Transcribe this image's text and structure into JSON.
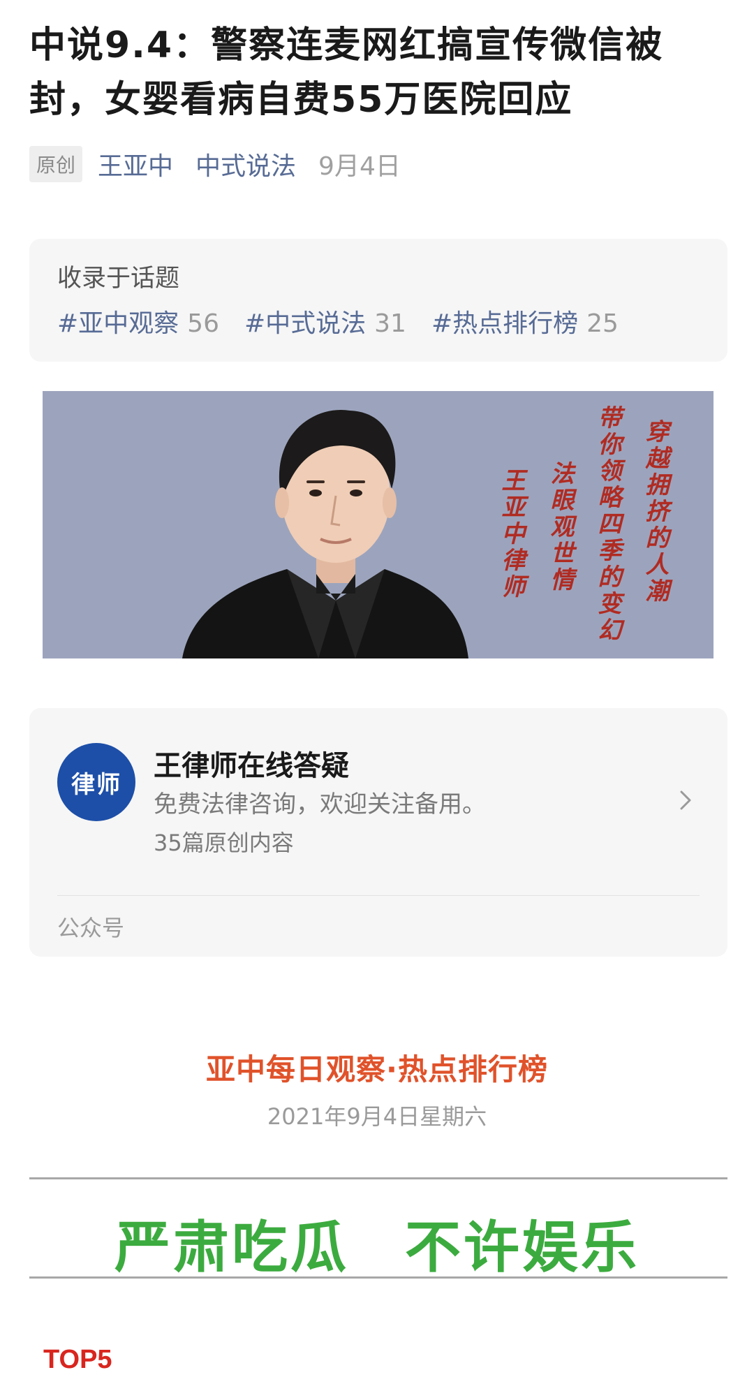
{
  "article": {
    "title": "中说9.4：警察连麦网红搞宣传微信被封，女婴看病自费55万医院回应",
    "original_badge": "原创",
    "author": "王亚中",
    "account": "中式说法",
    "date": "9月4日"
  },
  "topics": {
    "label": "收录于话题",
    "tags": [
      {
        "name": "#亚中观察",
        "count": "56"
      },
      {
        "name": "#中式说法",
        "count": "31"
      },
      {
        "name": "#热点排行榜",
        "count": "25"
      }
    ]
  },
  "banner": {
    "calligraphy_lines": [
      "穿越拥挤的人潮",
      "带你领略四季的变幻",
      "法眼观世情",
      "王亚中律师"
    ]
  },
  "account_card": {
    "avatar_text": "律师",
    "name": "王律师在线答疑",
    "description": "免费法律咨询，欢迎关注备用。",
    "count": "35篇原创内容",
    "type": "公众号"
  },
  "section": {
    "heading": "亚中每日观察·热点排行榜",
    "date": "2021年9月4日星期六",
    "slogan_left": "严肃吃瓜",
    "slogan_right": "不许娱乐",
    "top_label": "TOP5"
  },
  "colors": {
    "link": "#576b95",
    "heading_orange": "#e0522a",
    "slogan_green": "#3cab3f",
    "top_red": "#d8261f",
    "calligraphy_red": "#b02b22"
  }
}
